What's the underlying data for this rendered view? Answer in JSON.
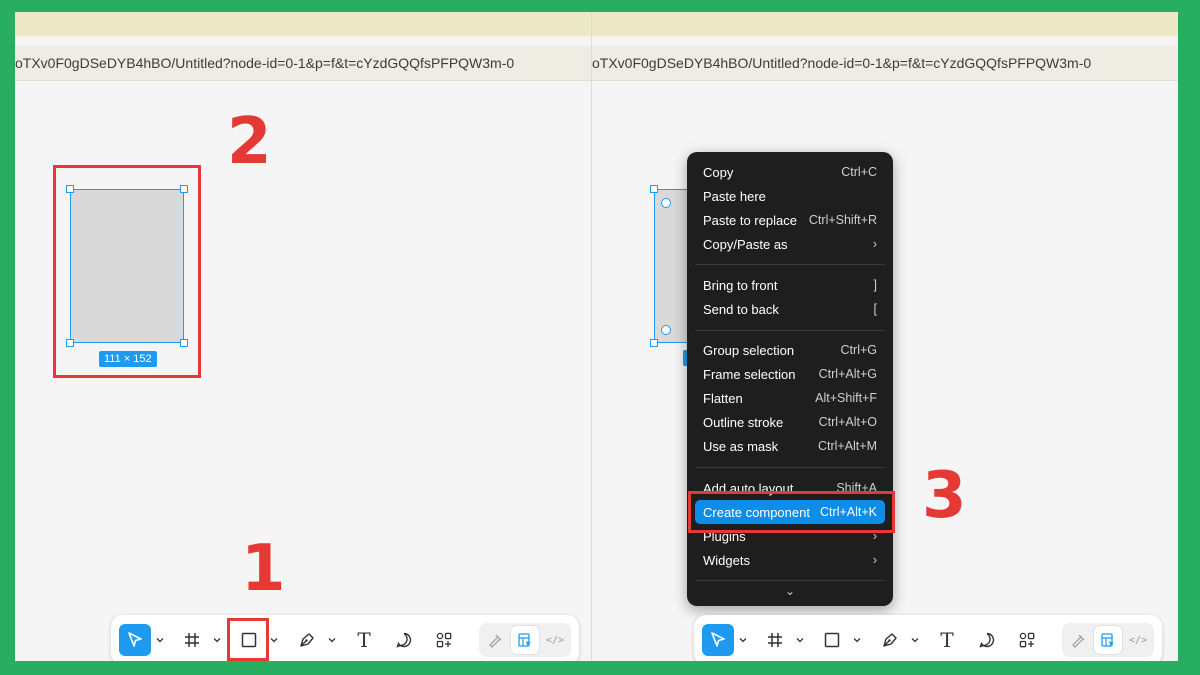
{
  "url_text": "oTXv0F0gDSeDYB4hBO/Untitled?node-id=0-1&p=f&t=cYzdGQQfsPFPQW3m-0",
  "steps": {
    "one": "1",
    "two": "2",
    "three": "3"
  },
  "canvas": {
    "dimension_label": "111 × 152"
  },
  "colors": {
    "accent": "#1e9bf0",
    "highlight": "#e53935",
    "frame": "#27ae60",
    "menu_bg": "#1e1e1e"
  },
  "toolbar": {
    "tools": [
      {
        "name": "move",
        "icon": "cursor-arrow-icon"
      },
      {
        "name": "frame",
        "icon": "frame-hash-icon"
      },
      {
        "name": "rectangle",
        "icon": "square-icon"
      },
      {
        "name": "pen",
        "icon": "pen-nib-icon"
      },
      {
        "name": "text",
        "icon": "text-t-icon",
        "glyph": "T"
      },
      {
        "name": "comment",
        "icon": "speech-bubble-icon"
      },
      {
        "name": "actions",
        "icon": "components-grid-icon"
      }
    ],
    "modes": [
      {
        "name": "draw",
        "icon": "draw-pen-icon"
      },
      {
        "name": "design",
        "icon": "design-mode-icon"
      },
      {
        "name": "dev",
        "icon": "code-brackets-icon",
        "glyph": "</>"
      }
    ]
  },
  "context_menu": {
    "groups": [
      [
        {
          "label": "Copy",
          "shortcut": "Ctrl+C"
        },
        {
          "label": "Paste here",
          "shortcut": ""
        },
        {
          "label": "Paste to replace",
          "shortcut": "Ctrl+Shift+R"
        },
        {
          "label": "Copy/Paste as",
          "shortcut": "›"
        }
      ],
      [
        {
          "label": "Bring to front",
          "shortcut": "]"
        },
        {
          "label": "Send to back",
          "shortcut": "["
        }
      ],
      [
        {
          "label": "Group selection",
          "shortcut": "Ctrl+G"
        },
        {
          "label": "Frame selection",
          "shortcut": "Ctrl+Alt+G"
        },
        {
          "label": "Flatten",
          "shortcut": "Alt+Shift+F"
        },
        {
          "label": "Outline stroke",
          "shortcut": "Ctrl+Alt+O"
        },
        {
          "label": "Use as mask",
          "shortcut": "Ctrl+Alt+M"
        }
      ],
      [
        {
          "label": "Add auto layout",
          "shortcut": "Shift+A"
        },
        {
          "label": "Create component",
          "shortcut": "Ctrl+Alt+K"
        },
        {
          "label": "Plugins",
          "shortcut": "›"
        },
        {
          "label": "Widgets",
          "shortcut": "›"
        }
      ]
    ],
    "more_indicator": "⌄"
  }
}
